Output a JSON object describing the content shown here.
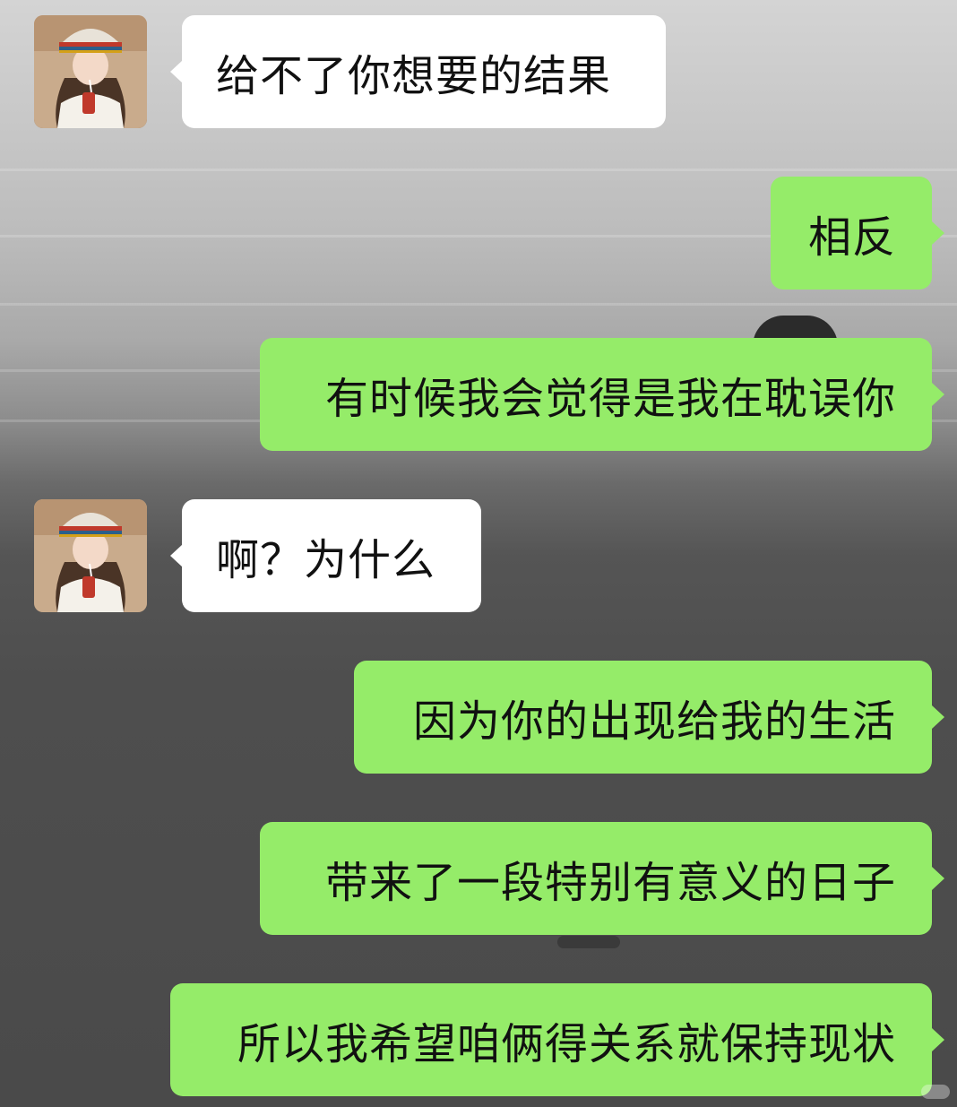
{
  "messages": [
    {
      "sender": "contact",
      "text": "给不了你想要的结果"
    },
    {
      "sender": "me",
      "text": "相反"
    },
    {
      "sender": "me",
      "text": "有时候我会觉得是我在耽误你"
    },
    {
      "sender": "contact",
      "text": "啊？为什么"
    },
    {
      "sender": "me",
      "text": "因为你的出现给我的生活"
    },
    {
      "sender": "me",
      "text": "带来了一段特别有意义的日子"
    },
    {
      "sender": "me",
      "text": "所以我希望咱俩得关系就保持现状"
    }
  ],
  "colors": {
    "incoming_bubble": "#ffffff",
    "outgoing_bubble": "#95ec69",
    "message_text": "#111111"
  },
  "icons": {
    "contact_avatar": "girl-in-bucket-hat-avatar"
  }
}
